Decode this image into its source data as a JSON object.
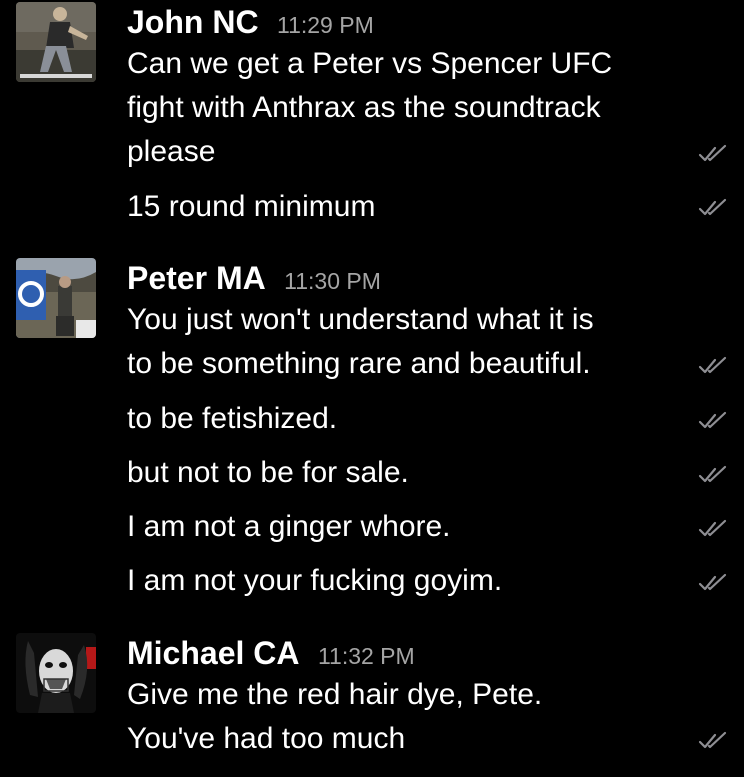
{
  "colors": {
    "background": "#000000",
    "text": "#ffffff",
    "timestamp": "#a5a5a5",
    "read_check": "#8e8e93"
  },
  "messages": [
    {
      "sender": "John NC",
      "time": "11:29 PM",
      "avatar_icon": "person-avatar-photo",
      "lines": [
        "Can we get a Peter vs Spencer UFC",
        "fight with Anthrax as the soundtrack",
        "please",
        "15 round minimum"
      ]
    },
    {
      "sender": "Peter MA",
      "time": "11:30 PM",
      "avatar_icon": "flag-avatar-photo",
      "lines": [
        "You just won't understand what it is",
        "to be something rare and beautiful.",
        "to be fetishized.",
        "but not to be for sale.",
        "I am not a ginger whore.",
        "I am not your fucking goyim."
      ]
    },
    {
      "sender": "Michael CA",
      "time": "11:32 PM",
      "avatar_icon": "masked-face-avatar-photo",
      "lines": [
        "Give me the red hair dye, Pete.",
        "You've had too much"
      ]
    }
  ],
  "read_icon": "double-check-icon"
}
